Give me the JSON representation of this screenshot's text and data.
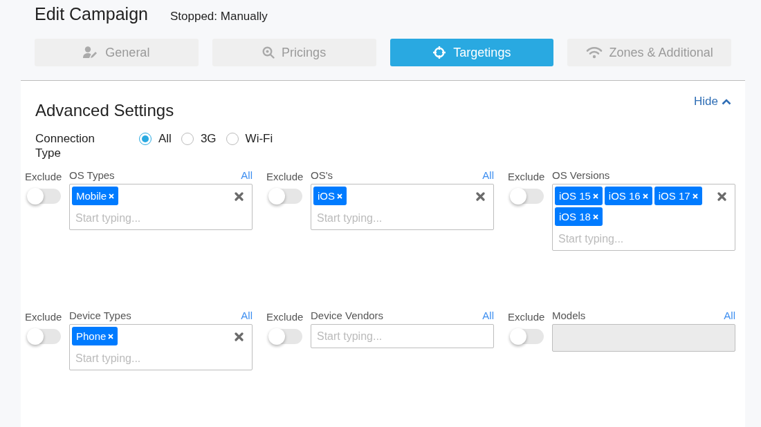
{
  "header": {
    "title": "Edit Campaign",
    "status": "Stopped: Manually"
  },
  "tabs": [
    {
      "label": "General",
      "selected": false
    },
    {
      "label": "Pricings",
      "selected": false
    },
    {
      "label": "Targetings",
      "selected": true
    },
    {
      "label": "Zones & Additional",
      "selected": false
    }
  ],
  "panel": {
    "title": "Advanced Settings",
    "hide_link": "Hide"
  },
  "connection": {
    "label": "Connection Type",
    "options": [
      {
        "label": "All",
        "selected": true
      },
      {
        "label": "3G",
        "selected": false
      },
      {
        "label": "Wi-Fi",
        "selected": false
      }
    ]
  },
  "filters": [
    {
      "exclude_label": "Exclude",
      "exclude_on": false,
      "label": "OS Types",
      "all_link": "All",
      "tags": [
        "Mobile"
      ],
      "placeholder": "Start typing...",
      "disabled": false
    },
    {
      "exclude_label": "Exclude",
      "exclude_on": false,
      "label": "OS's",
      "all_link": "All",
      "tags": [
        "iOS"
      ],
      "placeholder": "Start typing...",
      "disabled": false
    },
    {
      "exclude_label": "Exclude",
      "exclude_on": false,
      "label": "OS Versions",
      "tags": [
        "iOS 15",
        "iOS 16",
        "iOS 17",
        "iOS 18"
      ],
      "placeholder": "Start typing...",
      "disabled": false
    },
    {
      "exclude_label": "Exclude",
      "exclude_on": false,
      "label": "Device Types",
      "all_link": "All",
      "tags": [
        "Phone"
      ],
      "placeholder": "Start typing...",
      "disabled": false
    },
    {
      "exclude_label": "Exclude",
      "exclude_on": false,
      "label": "Device Vendors",
      "all_link": "All",
      "placeholder": "Start typing...",
      "disabled": false
    },
    {
      "exclude_label": "Exclude",
      "exclude_on": false,
      "label": "Models",
      "all_link": "All",
      "disabled": true
    }
  ]
}
